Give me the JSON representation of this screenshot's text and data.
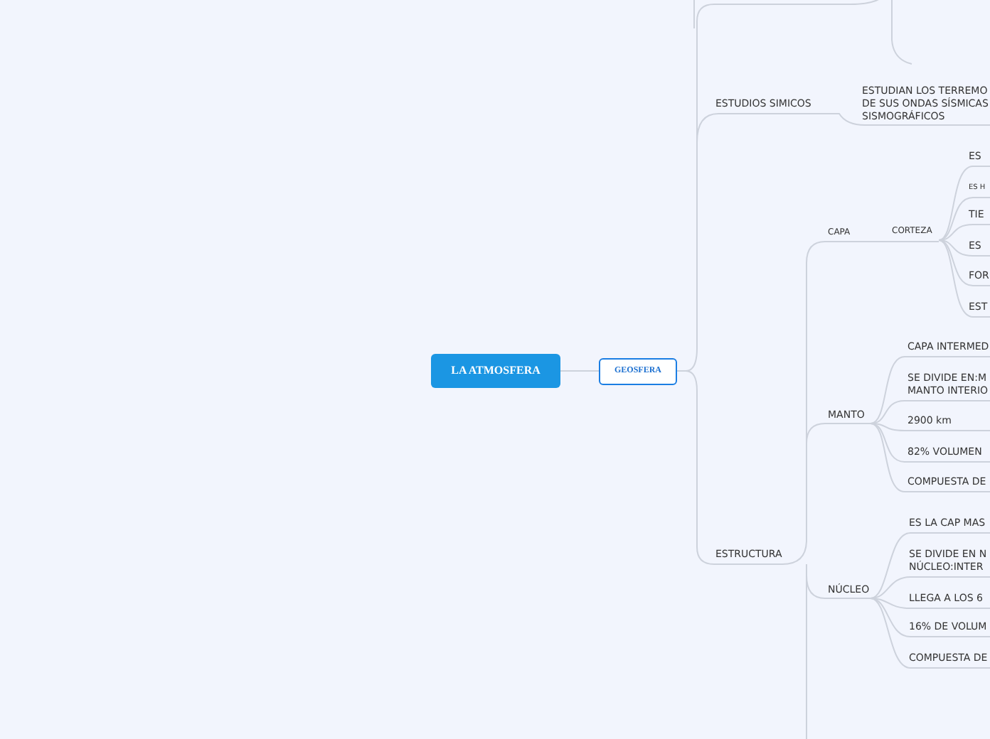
{
  "root": {
    "label": "LA ATMOSFERA"
  },
  "main_topic": {
    "label": "GEOSFERA"
  },
  "branches": [
    {
      "label": "ESTUDIOS SIMICOS",
      "children": [
        {
          "label": "ESTUDIAN LOS TERREMO\nDE SUS ONDAS SÍSMICAS\nSISMOGRÁFICOS"
        }
      ]
    },
    {
      "label": "ESTRUCTURA",
      "children": [
        {
          "label": "CAPA",
          "children": [
            {
              "label": "CORTEZA",
              "children": [
                {
                  "label": "ES"
                },
                {
                  "label": "ES H"
                },
                {
                  "label": "TIE"
                },
                {
                  "label": "ES"
                },
                {
                  "label": "FOR"
                },
                {
                  "label": "EST"
                }
              ]
            }
          ]
        },
        {
          "label": "MANTO",
          "children": [
            {
              "label": "CAPA INTERMED"
            },
            {
              "label": "SE DIVIDE EN:M\nMANTO INTERIO"
            },
            {
              "label": "2900 km"
            },
            {
              "label": "82% VOLUMEN"
            },
            {
              "label": "COMPUESTA DE"
            }
          ]
        },
        {
          "label": "NÚCLEO",
          "children": [
            {
              "label": "ES LA CAP MAS"
            },
            {
              "label": "SE DIVIDE EN N\nNÚCLEO:INTER"
            },
            {
              "label": "LLEGA A LOS 6"
            },
            {
              "label": "16% DE VOLUM"
            },
            {
              "label": "COMPUESTA DE"
            }
          ]
        }
      ]
    }
  ]
}
